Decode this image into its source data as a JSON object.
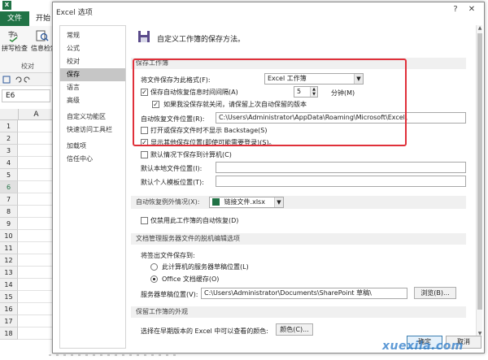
{
  "excel": {
    "app_icon": "X",
    "file_tab": "文件",
    "start_tab": "开始",
    "ribbon_btn1": "拼写检查",
    "ribbon_btn2": "信息检索",
    "proof_group": "校对",
    "name_box": "E6",
    "column_header": "A",
    "rows": [
      "1",
      "2",
      "3",
      "4",
      "5",
      "6",
      "7",
      "8",
      "9",
      "10",
      "11",
      "12",
      "13",
      "14",
      "15",
      "16",
      "17",
      "18"
    ],
    "selected_row": "6"
  },
  "dialog": {
    "title": "Excel 选项",
    "nav": [
      "常规",
      "公式",
      "校对",
      "保存",
      "语言",
      "高级",
      "自定义功能区",
      "快速访问工具栏",
      "加载项",
      "信任中心"
    ],
    "selected_nav": "保存",
    "header_text": "自定义工作簿的保存方法。",
    "sections": {
      "save_workbooks": "保存工作簿",
      "autorecover_exceptions_label": "自动恢复例外情况(X):",
      "offline_editing": "文档管理服务器文件的脱机编辑选项",
      "preserve_visual": "保留工作簿的外观"
    },
    "save_format_label": "将文件保存为此格式(F):",
    "save_format_value": "Excel 工作簿",
    "autorecover_checkbox_label": "保存自动恢复信息时间间隔(A)",
    "autorecover_minutes": "5",
    "minutes_unit": "分钟(M)",
    "keep_last_label": "如果我没保存就关闭，请保留上次自动保留的版本",
    "autorecover_location_label": "自动恢复文件位置(R):",
    "autorecover_location_value": "C:\\Users\\Administrator\\AppData\\Roaming\\Microsoft\\Excel\\",
    "no_backstage_label": "打开或保存文件时不显示 Backstage(S)",
    "show_additional_label": "显示其他保存位置(即使可能需要登录)(S)。",
    "default_save_computer_label": "默认情况下保存到计算机(C)",
    "default_local_location_label": "默认本地文件位置(I):",
    "default_local_location_value": "",
    "default_personal_templates_label": "默认个人模板位置(T):",
    "default_personal_templates_value": "",
    "autorecover_workbook_value": "链接文件.xlsx",
    "disable_autorecover_label": "仅禁用此工作簿的自动恢复(D)",
    "save_checked_out_label": "将签出文件保存到:",
    "server_drafts_radio": "此计算机的服务器草稿位置(L)",
    "office_cache_radio": "Office 文档缓存(O)",
    "server_drafts_location_label": "服务器草稿位置(V):",
    "server_drafts_location_value": "C:\\Users\\Administrator\\Documents\\SharePoint 草稿\\",
    "browse_button": "浏览(B)...",
    "colors_label": "选择在早期版本的 Excel 中可以查看的颜色:",
    "colors_button": "颜色(C)...",
    "ok_button": "确定",
    "cancel_button": "取消",
    "help_glyph": "?",
    "close_glyph": "✕"
  },
  "watermark": "xuexila.com",
  "colors": {
    "excel_green": "#217346",
    "highlight_red": "#e0303a",
    "nav_selected": "#c6c6c6"
  }
}
